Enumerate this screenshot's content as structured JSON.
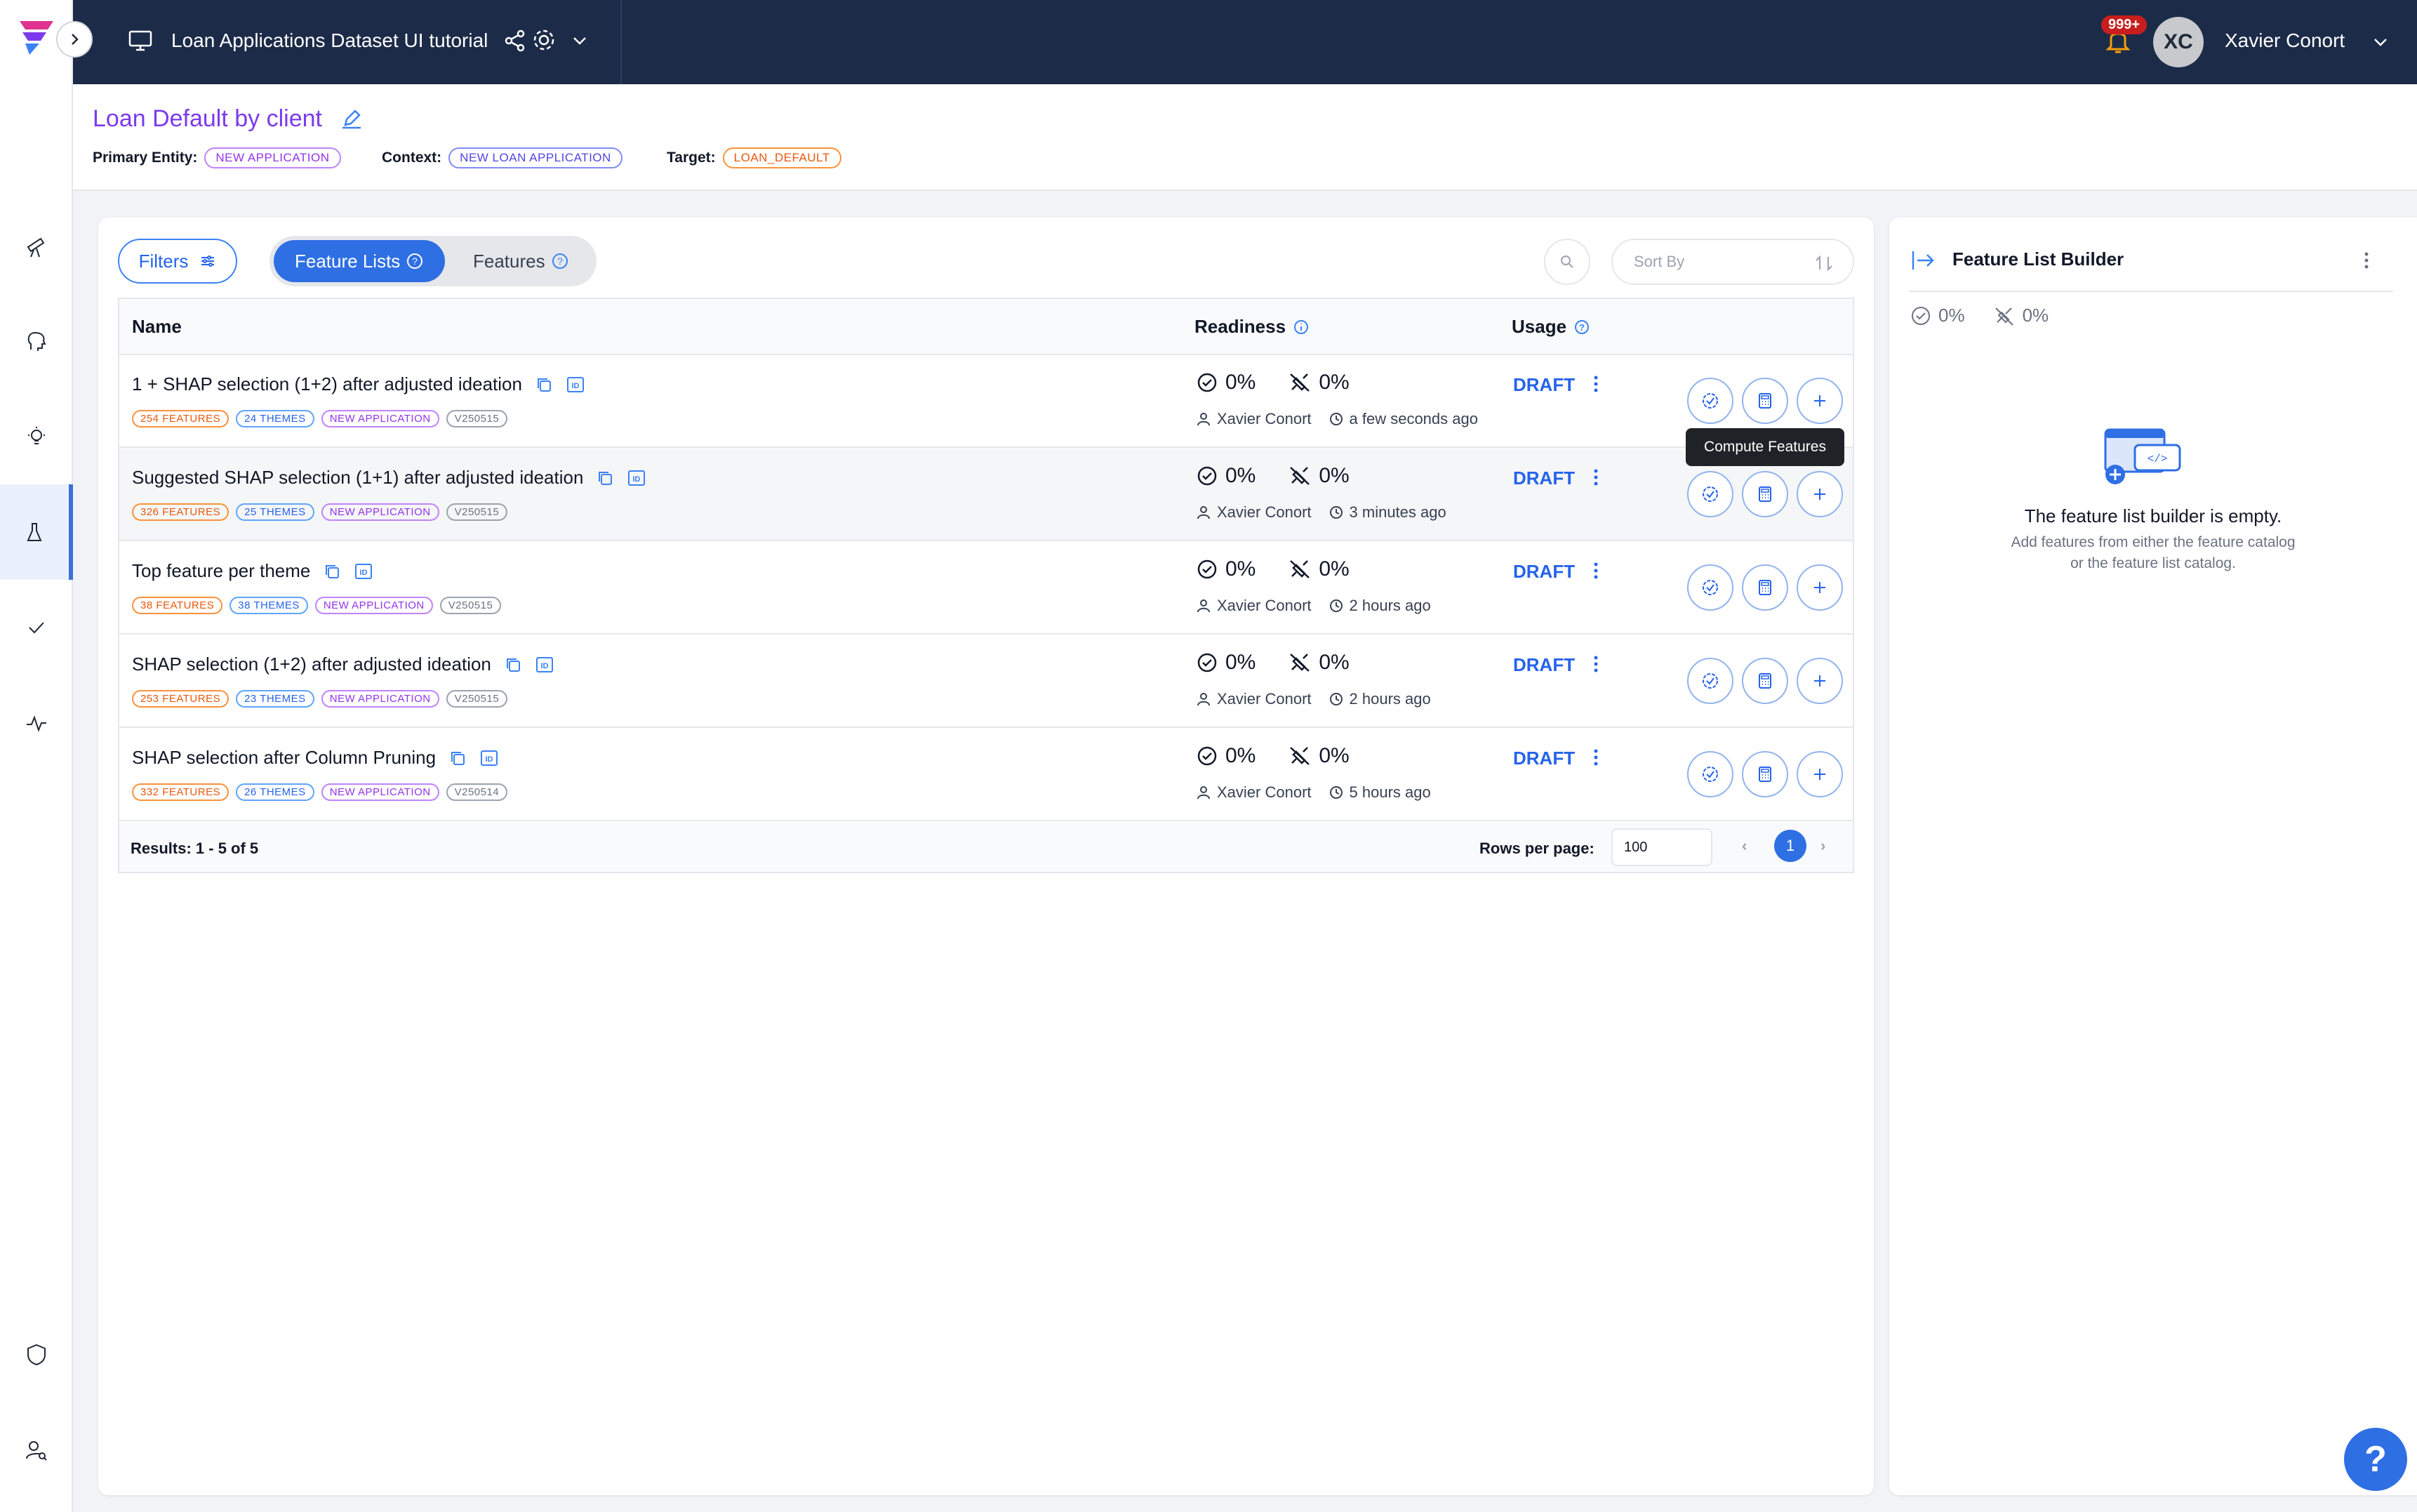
{
  "app": {
    "project_name": "Loan Applications Dataset UI tutorial",
    "notifications_badge": "999+",
    "user_initials": "XC",
    "user_name": "Xavier Conort"
  },
  "header": {
    "title": "Loan Default by client",
    "primary_entity_label": "Primary Entity:",
    "primary_entity_value": "NEW APPLICATION",
    "context_label": "Context:",
    "context_value": "NEW LOAN APPLICATION",
    "target_label": "Target:",
    "target_value": "LOAN_DEFAULT"
  },
  "toolbar": {
    "filters_label": "Filters",
    "tab_feature_lists": "Feature Lists",
    "tab_features": "Features",
    "sort_placeholder": "Sort By"
  },
  "table": {
    "columns": {
      "name": "Name",
      "readiness": "Readiness",
      "usage": "Usage"
    },
    "rows": [
      {
        "name": "1 + SHAP selection (1+2) after adjusted ideation",
        "features": "254 FEATURES",
        "themes": "24 THEMES",
        "entity": "NEW APPLICATION",
        "version": "V250515",
        "readiness": "0%",
        "online": "0%",
        "author": "Xavier Conort",
        "time": "a few seconds ago",
        "status": "DRAFT"
      },
      {
        "name": "Suggested SHAP selection (1+1) after adjusted ideation",
        "features": "326 FEATURES",
        "themes": "25 THEMES",
        "entity": "NEW APPLICATION",
        "version": "V250515",
        "readiness": "0%",
        "online": "0%",
        "author": "Xavier Conort",
        "time": "3 minutes ago",
        "status": "DRAFT"
      },
      {
        "name": "Top feature per theme",
        "features": "38 FEATURES",
        "themes": "38 THEMES",
        "entity": "NEW APPLICATION",
        "version": "V250515",
        "readiness": "0%",
        "online": "0%",
        "author": "Xavier Conort",
        "time": "2 hours ago",
        "status": "DRAFT"
      },
      {
        "name": "SHAP selection (1+2) after adjusted ideation",
        "features": "253 FEATURES",
        "themes": "23 THEMES",
        "entity": "NEW APPLICATION",
        "version": "V250515",
        "readiness": "0%",
        "online": "0%",
        "author": "Xavier Conort",
        "time": "2 hours ago",
        "status": "DRAFT"
      },
      {
        "name": "SHAP selection after Column Pruning",
        "features": "332 FEATURES",
        "themes": "26 THEMES",
        "entity": "NEW APPLICATION",
        "version": "V250514",
        "readiness": "0%",
        "online": "0%",
        "author": "Xavier Conort",
        "time": "5 hours ago",
        "status": "DRAFT"
      }
    ],
    "results": "Results: 1 - 5 of 5",
    "rows_per_page_label": "Rows per page:",
    "rows_per_page_value": "100",
    "current_page": "1"
  },
  "tooltip": "Compute Features",
  "builder": {
    "title": "Feature List Builder",
    "readiness": "0%",
    "online": "0%",
    "empty_title": "The feature list builder is empty.",
    "empty_desc_line1": "Add features from either the feature catalog",
    "empty_desc_line2": "or the feature list catalog."
  },
  "help_label": "?",
  "icons": [
    "logo-icon",
    "telescope-icon",
    "brain-icon",
    "lightbulb-icon",
    "flask-icon",
    "check-icon",
    "activity-icon",
    "shield-icon",
    "user-search-icon",
    "monitor-icon",
    "share-icon",
    "gear-icon",
    "bell-icon",
    "edit-icon",
    "search-icon",
    "sort-icon",
    "copy-icon",
    "id-icon",
    "kebab-icon",
    "compute-icon",
    "calculator-icon",
    "plus-icon"
  ],
  "colors": {
    "topbar": "#1c2b48",
    "accent": "#2f6fe4",
    "title": "#7c3aed"
  }
}
